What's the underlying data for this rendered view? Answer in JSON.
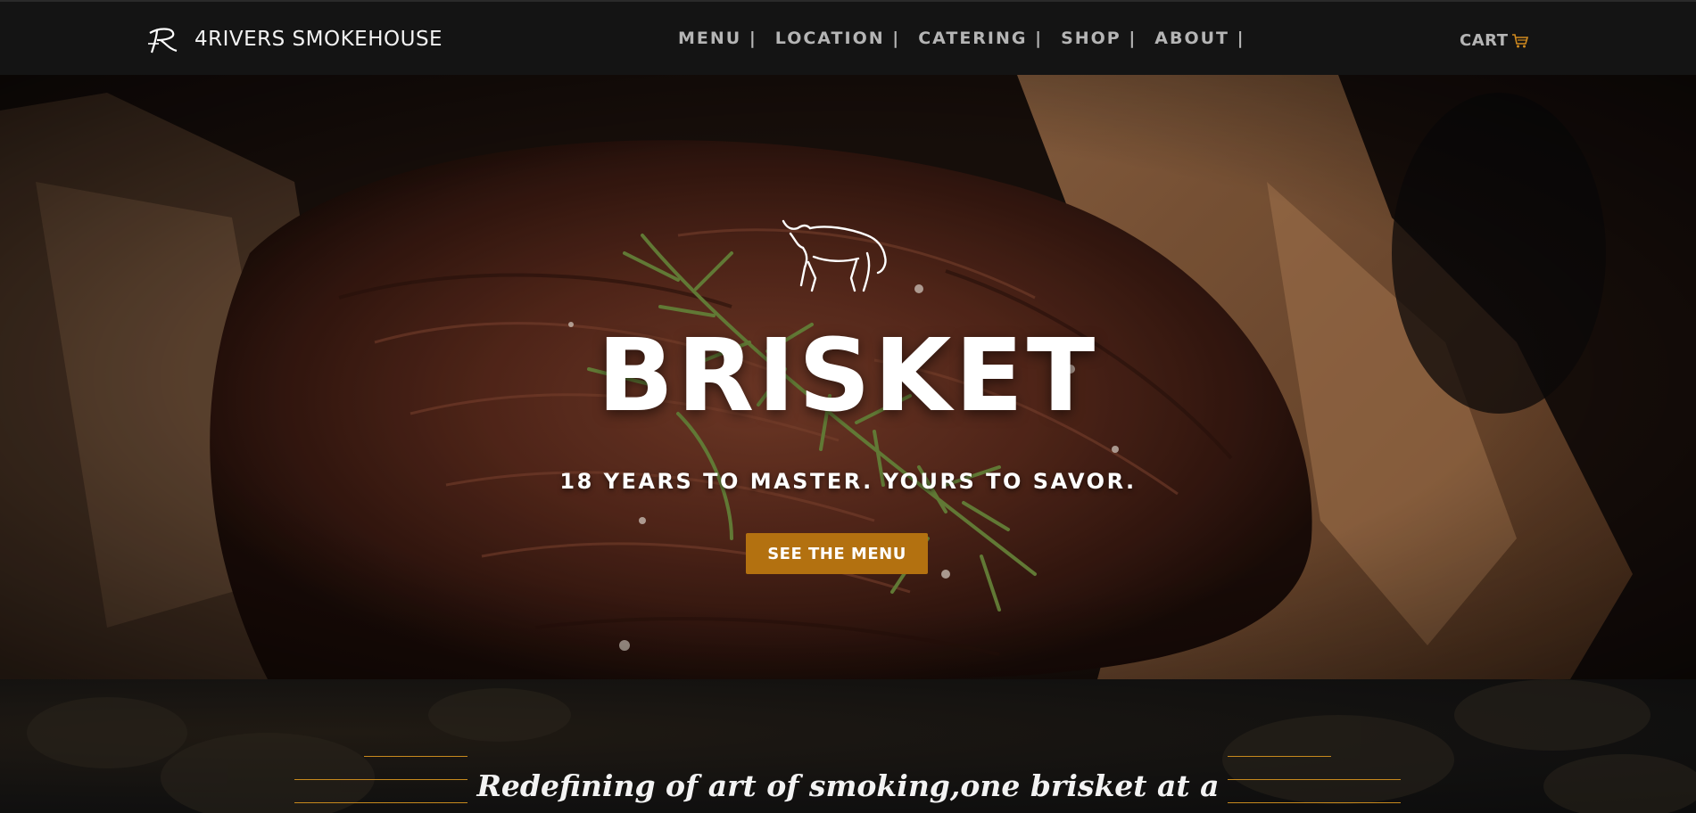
{
  "brand": {
    "name": "4RIVERS SMOKEHOUSE",
    "logo_icon": "r-monogram-logo-icon"
  },
  "nav": {
    "items": [
      {
        "label": "MENU |"
      },
      {
        "label": "LOCATION |"
      },
      {
        "label": "CATERING |"
      },
      {
        "label": "SHOP |"
      },
      {
        "label": "ABOUT |"
      }
    ],
    "cart_label": "CART",
    "cart_icon": "shopping-cart-icon"
  },
  "hero": {
    "icon": "bull-icon",
    "title": "BRISKET",
    "subtitle": "18 YEARS TO MASTER. YOURS TO SAVOR.",
    "button_label": "SEE THE MENU"
  },
  "band": {
    "tagline": "Redefining of art of smoking,one brisket at a"
  },
  "colors": {
    "navbar_bg": "#141414",
    "nav_text": "#b5b5b5",
    "accent": "#b37110",
    "deco_line": "#c7891d",
    "cart_icon": "#d08a1e"
  }
}
